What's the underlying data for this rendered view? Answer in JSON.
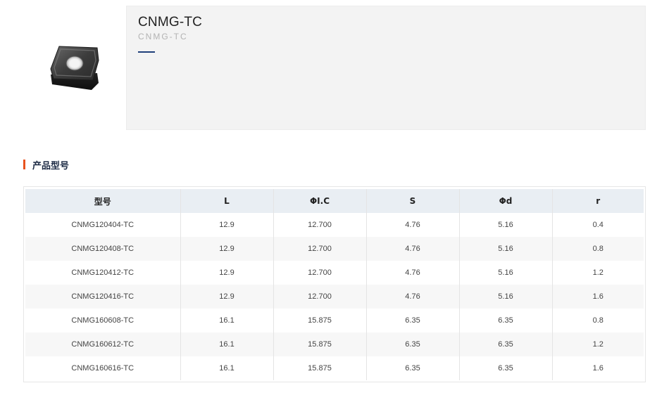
{
  "product": {
    "title": "CNMG-TC",
    "subtitle": "CNMG-TC",
    "image_icon": "insert-product-image"
  },
  "colors": {
    "accent_marker": "#e8531f",
    "underline": "#1f3f7a",
    "header_bg": "#e9eef3",
    "panel_bg": "#f3f3f3"
  },
  "section": {
    "title": "产品型号"
  },
  "table": {
    "headers": [
      "型号",
      "L",
      "ΦI.C",
      "S",
      "Φd",
      "r"
    ],
    "rows": [
      [
        "CNMG120404-TC",
        "12.9",
        "12.700",
        "4.76",
        "5.16",
        "0.4"
      ],
      [
        "CNMG120408-TC",
        "12.9",
        "12.700",
        "4.76",
        "5.16",
        "0.8"
      ],
      [
        "CNMG120412-TC",
        "12.9",
        "12.700",
        "4.76",
        "5.16",
        "1.2"
      ],
      [
        "CNMG120416-TC",
        "12.9",
        "12.700",
        "4.76",
        "5.16",
        "1.6"
      ],
      [
        "CNMG160608-TC",
        "16.1",
        "15.875",
        "6.35",
        "6.35",
        "0.8"
      ],
      [
        "CNMG160612-TC",
        "16.1",
        "15.875",
        "6.35",
        "6.35",
        "1.2"
      ],
      [
        "CNMG160616-TC",
        "16.1",
        "15.875",
        "6.35",
        "6.35",
        "1.6"
      ]
    ]
  }
}
